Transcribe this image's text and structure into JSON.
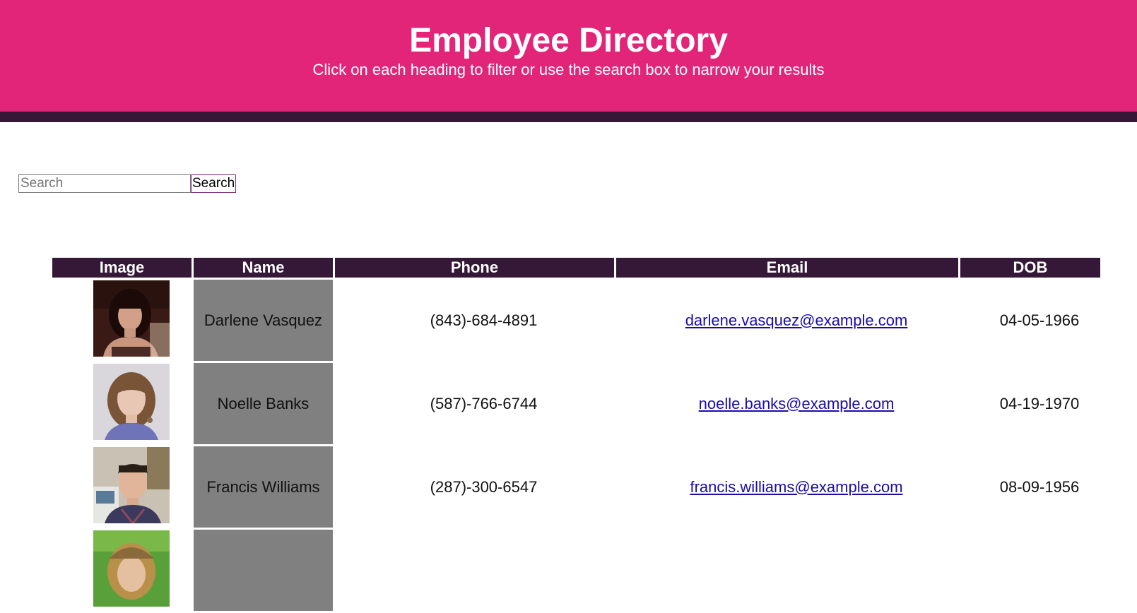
{
  "header": {
    "title": "Employee Directory",
    "subtitle": "Click on each heading to filter or use the search box to narrow your results"
  },
  "colors": {
    "header_bg": "#e3257a",
    "accent_dark": "#351737",
    "name_cell_bg": "#808080",
    "link": "#1a0dab"
  },
  "search": {
    "placeholder": "Search",
    "value": "",
    "button_label": "Search"
  },
  "table": {
    "columns": [
      "Image",
      "Name",
      "Phone",
      "Email",
      "DOB"
    ],
    "rows": [
      {
        "image": "photo-darlene-vasquez",
        "name": "Darlene Vasquez",
        "phone": "(843)-684-4891",
        "email": "darlene.vasquez@example.com",
        "dob": "04-05-1966"
      },
      {
        "image": "photo-noelle-banks",
        "name": "Noelle Banks",
        "phone": "(587)-766-6744",
        "email": "noelle.banks@example.com",
        "dob": "04-19-1970"
      },
      {
        "image": "photo-francis-williams",
        "name": "Francis Williams",
        "phone": "(287)-300-6547",
        "email": "francis.williams@example.com",
        "dob": "08-09-1956"
      },
      {
        "image": "photo-partial",
        "name": "",
        "phone": "",
        "email": "",
        "dob": ""
      }
    ]
  }
}
